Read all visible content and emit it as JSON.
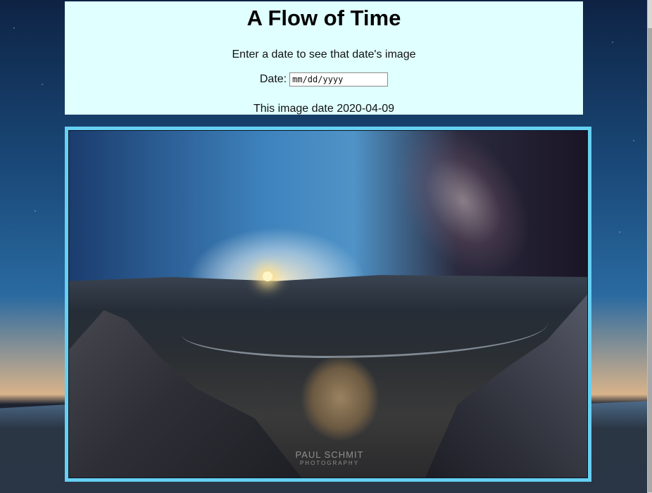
{
  "header": {
    "title": "A Flow of Time",
    "subtitle": "Enter a date to see that date's image",
    "date_label": "Date:",
    "date_placeholder": "mm/dd/yyyy",
    "image_date_text": "This image date 2020-04-09"
  },
  "photo": {
    "watermark_line1": "PAUL SCHMIT",
    "watermark_line2": "PHOTOGRAPHY"
  },
  "colors": {
    "header_bg": "#e0ffff",
    "frame_border": "#66d0f2"
  }
}
